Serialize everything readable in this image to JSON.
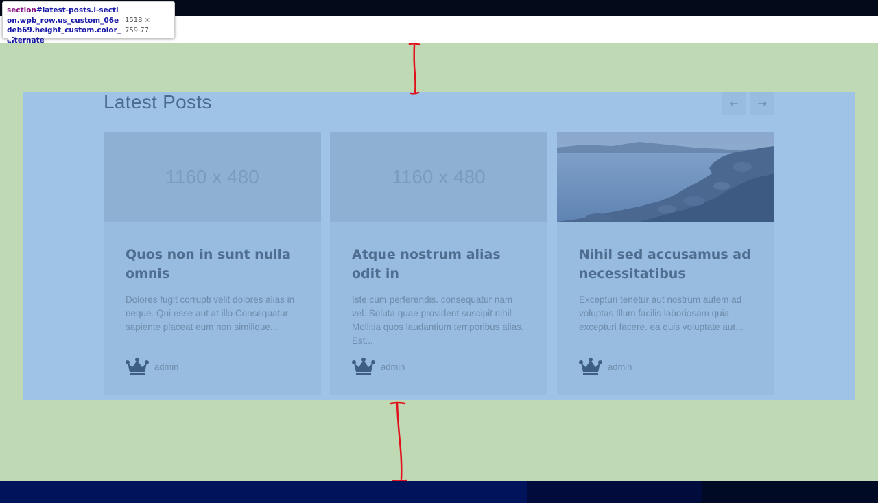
{
  "devtools_tooltip": {
    "selector_tag": "section",
    "selector_rest": "#latest-posts.l-section.wpb_row.us_custom_06edeb69.height_custom.color_alternate",
    "dimensions": "1518 × 759.77"
  },
  "section": {
    "title": "Latest Posts",
    "prev_label": "←",
    "next_label": "→"
  },
  "posts": [
    {
      "image_placeholder": "1160 x 480",
      "title": "Quos non in sunt nulla omnis",
      "excerpt": "Dolores fugit corrupti velit dolores alias in neque. Qui esse aut at illo Consequatur sapiente placeat eum non similique...",
      "author": "admin"
    },
    {
      "image_placeholder": "1160 x 480",
      "title": "Atque nostrum alias odit in",
      "excerpt": "Iste cum perferendis. consequatur nam vel. Soluta quae provident suscipit nihil Mollitia quos laudantium temporibus alias. Est...",
      "author": "admin"
    },
    {
      "image_placeholder": "",
      "title": "Nihil sed accusamus ad necessitatibus",
      "excerpt": "Excepturi tenetur aut nostrum autem ad voluptas Illum facilis laboriosam quia excepturi facere. ea quis voluptate aut...",
      "author": "admin"
    }
  ],
  "colors": {
    "page_overlay": "#bfd9b4",
    "section_overlay": "#9fc3e6",
    "annotation": "#e0111a",
    "footer": "#01145b"
  },
  "icons": {
    "author": "crown-icon",
    "prev": "arrow-left-icon",
    "next": "arrow-right-icon"
  }
}
